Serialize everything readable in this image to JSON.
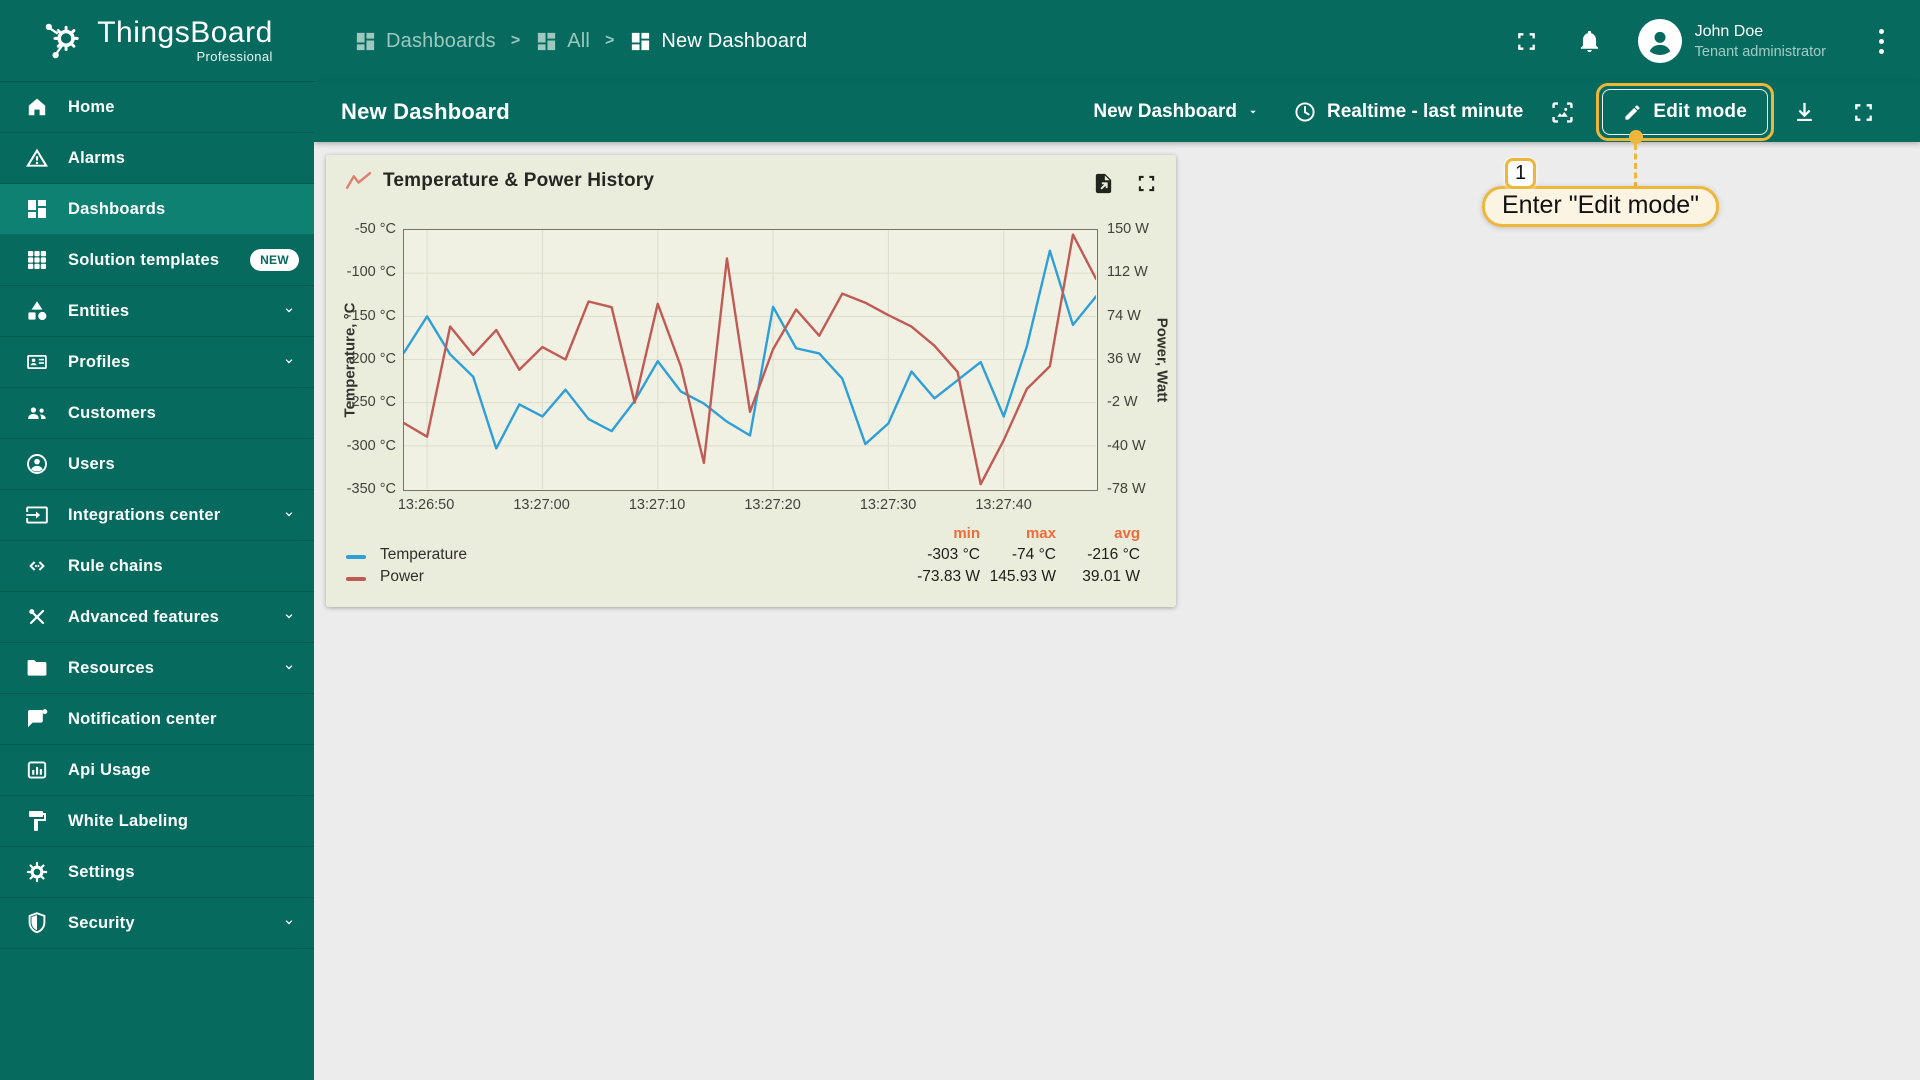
{
  "brand": {
    "name": "ThingsBoard",
    "subtitle": "Professional",
    "logo_icon": "logo-icon"
  },
  "breadcrumb": {
    "separator": ">",
    "items": [
      {
        "label": "Dashboards",
        "icon": "dashboard-icon",
        "current": false
      },
      {
        "label": "All",
        "icon": "dashboard-icon",
        "current": false
      },
      {
        "label": "New Dashboard",
        "icon": "dashboard-icon",
        "current": true
      }
    ]
  },
  "topbar": {
    "fullscreen_icon": "fullscreen-icon",
    "notifications_icon": "bell-icon",
    "user_menu_icon": "kebab-icon",
    "user": {
      "name": "John Doe",
      "role": "Tenant administrator",
      "avatar_icon": "person-icon"
    }
  },
  "sidebar": {
    "items": [
      {
        "label": "Home",
        "icon": "home-icon",
        "selected": false,
        "badge": "",
        "chevron": false
      },
      {
        "label": "Alarms",
        "icon": "alarms-icon",
        "selected": false,
        "badge": "",
        "chevron": false
      },
      {
        "label": "Dashboards",
        "icon": "dashboards-icon",
        "selected": true,
        "badge": "",
        "chevron": false
      },
      {
        "label": "Solution templates",
        "icon": "solution-templates-icon",
        "selected": false,
        "badge": "NEW",
        "chevron": false
      },
      {
        "label": "Entities",
        "icon": "entities-icon",
        "selected": false,
        "badge": "",
        "chevron": true
      },
      {
        "label": "Profiles",
        "icon": "profiles-icon",
        "selected": false,
        "badge": "",
        "chevron": true
      },
      {
        "label": "Customers",
        "icon": "customers-icon",
        "selected": false,
        "badge": "",
        "chevron": false
      },
      {
        "label": "Users",
        "icon": "users-icon",
        "selected": false,
        "badge": "",
        "chevron": false
      },
      {
        "label": "Integrations center",
        "icon": "integrations-icon",
        "selected": false,
        "badge": "",
        "chevron": true
      },
      {
        "label": "Rule chains",
        "icon": "rule-chains-icon",
        "selected": false,
        "badge": "",
        "chevron": false
      },
      {
        "label": "Advanced features",
        "icon": "advanced-features-icon",
        "selected": false,
        "badge": "",
        "chevron": true
      },
      {
        "label": "Resources",
        "icon": "resources-icon",
        "selected": false,
        "badge": "",
        "chevron": true
      },
      {
        "label": "Notification center",
        "icon": "notification-icon",
        "selected": false,
        "badge": "",
        "chevron": false
      },
      {
        "label": "Api Usage",
        "icon": "api-usage-icon",
        "selected": false,
        "badge": "",
        "chevron": false
      },
      {
        "label": "White Labeling",
        "icon": "white-labeling-icon",
        "selected": false,
        "badge": "",
        "chevron": false
      },
      {
        "label": "Settings",
        "icon": "settings-icon",
        "selected": false,
        "badge": "",
        "chevron": false
      },
      {
        "label": "Security",
        "icon": "security-icon",
        "selected": false,
        "badge": "",
        "chevron": true
      }
    ]
  },
  "toolbar": {
    "title": "New Dashboard",
    "dashboard_select": "New Dashboard",
    "time_window": "Realtime - last minute",
    "edit_label": "Edit mode",
    "clock_icon": "clock-icon",
    "screenshot_icon": "screenshot-icon",
    "pencil_icon": "pencil-icon",
    "download_icon": "download-icon",
    "fullscreen_icon": "fullscreen-icon"
  },
  "annotation": {
    "step": "1",
    "text": "Enter \"Edit mode\""
  },
  "widget": {
    "title": "Temperature & Power History",
    "title_icon": "timeseries-icon",
    "export_icon": "export-file-icon",
    "fullscreen_icon": "fullscreen-icon",
    "legend": {
      "columns": [
        "min",
        "max",
        "avg"
      ],
      "rows": [
        {
          "name": "Temperature",
          "color": "#2f9fd8",
          "min": "-303 °C",
          "max": "-74 °C",
          "avg": "-216 °C"
        },
        {
          "name": "Power",
          "color": "#c05a55",
          "min": "-73.83 W",
          "max": "145.93 W",
          "avg": "39.01 W"
        }
      ]
    }
  },
  "chart_data": {
    "type": "line",
    "title": "Temperature & Power History",
    "grid": true,
    "legend_position": "bottom",
    "x": [
      "13:26:48",
      "13:26:50",
      "13:26:52",
      "13:26:54",
      "13:26:56",
      "13:26:58",
      "13:27:00",
      "13:27:02",
      "13:27:04",
      "13:27:06",
      "13:27:08",
      "13:27:10",
      "13:27:12",
      "13:27:14",
      "13:27:16",
      "13:27:18",
      "13:27:20",
      "13:27:22",
      "13:27:24",
      "13:27:26",
      "13:27:28",
      "13:27:30",
      "13:27:32",
      "13:27:34",
      "13:27:36",
      "13:27:38",
      "13:27:40",
      "13:27:42",
      "13:27:44",
      "13:27:46",
      "13:27:48"
    ],
    "x_ticks": [
      "13:26:50",
      "13:27:00",
      "13:27:10",
      "13:27:20",
      "13:27:30",
      "13:27:40"
    ],
    "y_left": {
      "label": "Temperature, °C",
      "min": -350,
      "max": -50,
      "ticks": [
        "-50 °C",
        "-100 °C",
        "-150 °C",
        "-200 °C",
        "-250 °C",
        "-300 °C",
        "-350 °C"
      ]
    },
    "y_right": {
      "label": "Power, Watt",
      "min": -78,
      "max": 150,
      "ticks": [
        "150 W",
        "112 W",
        "74 W",
        "36 W",
        "-2 W",
        "-40 W",
        "-78 W"
      ]
    },
    "series": [
      {
        "name": "Temperature",
        "axis": "left",
        "color": "#2f9fd8",
        "unit": "°C",
        "values": [
          -192,
          -150,
          -194,
          -220,
          -303,
          -252,
          -266,
          -235,
          -269,
          -283,
          -248,
          -202,
          -237,
          -251,
          -272,
          -288,
          -139,
          -187,
          -193,
          -222,
          -298,
          -274,
          -214,
          -245,
          -224,
          -203,
          -266,
          -185,
          -74,
          -160,
          -127
        ]
      },
      {
        "name": "Power",
        "axis": "right",
        "color": "#c05a55",
        "unit": "W",
        "values": [
          -20,
          -32,
          65,
          40,
          62,
          27,
          47,
          36,
          87,
          82,
          -2,
          85,
          30,
          -55,
          125,
          -10,
          45,
          80,
          57,
          94,
          86,
          75,
          65,
          48,
          25,
          -73.83,
          -35,
          10,
          30,
          145.93,
          107
        ]
      }
    ]
  },
  "colors": {
    "sidebar_teal": "#066a5e",
    "selected_teal": "#0f8173",
    "highlight_gold": "#eeb73c",
    "card_background": "#ebeddc",
    "legend_header": "#ee6a38",
    "temperature_series": "#2f9fd8",
    "power_series": "#c05a55"
  }
}
